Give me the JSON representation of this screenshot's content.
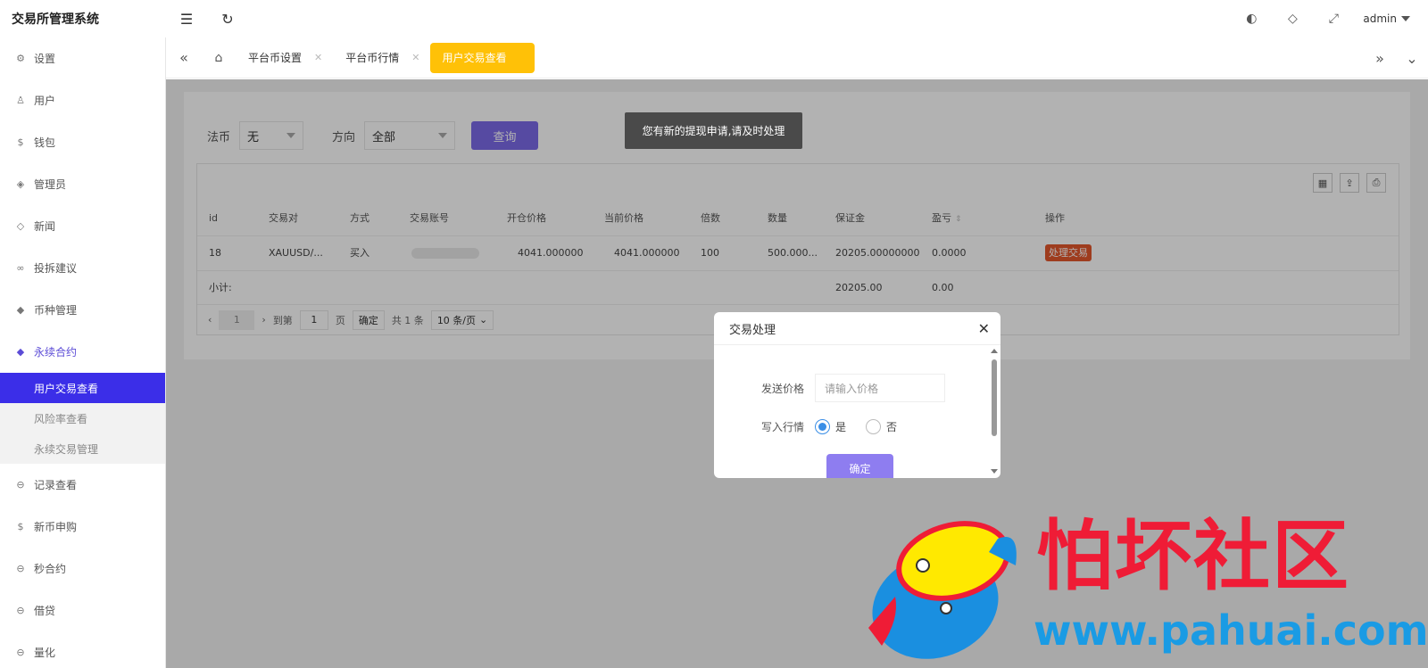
{
  "app": {
    "title": "交易所管理系统"
  },
  "header": {
    "user": "admin"
  },
  "sidebar": {
    "items": [
      {
        "label": "设置",
        "icon": "gear-icon"
      },
      {
        "label": "用户",
        "icon": "user-icon"
      },
      {
        "label": "钱包",
        "icon": "coin-icon"
      },
      {
        "label": "管理员",
        "icon": "shield-icon"
      },
      {
        "label": "新闻",
        "icon": "tag-icon"
      },
      {
        "label": "投拆建议",
        "icon": "link-icon"
      },
      {
        "label": "币种管理",
        "icon": "diamond-icon"
      },
      {
        "label": "永续合约",
        "icon": "diamond-icon"
      },
      {
        "label": "记录查看",
        "icon": "clock-icon"
      },
      {
        "label": "新币申购",
        "icon": "coin-icon"
      },
      {
        "label": "秒合约",
        "icon": "clock-icon"
      },
      {
        "label": "借贷",
        "icon": "clock-icon"
      },
      {
        "label": "量化",
        "icon": "clock-icon"
      }
    ],
    "submenu": [
      "用户交易查看",
      "风险率查看",
      "永续交易管理"
    ]
  },
  "tabs": [
    "平台币设置",
    "平台币行情",
    "用户交易查看"
  ],
  "filter": {
    "fiat_label": "法币",
    "fiat_value": "无",
    "direction_label": "方向",
    "direction_value": "全部",
    "query_button": "查询"
  },
  "table": {
    "columns": [
      "id",
      "交易对",
      "方式",
      "交易账号",
      "开仓价格",
      "当前价格",
      "倍数",
      "数量",
      "保证金",
      "盈亏",
      "操作"
    ],
    "rows": [
      {
        "id": "18",
        "pair": "XAUUSD/...",
        "method": "买入",
        "open_price": "4041.000000",
        "current_price": "4041.000000",
        "multiple": "100",
        "quantity": "500.000...",
        "margin": "20205.00000000",
        "pnl": "0.0000",
        "action": "处理交易"
      }
    ],
    "subtotal": {
      "label": "小计:",
      "margin": "20205.00",
      "pnl": "0.00"
    }
  },
  "pager": {
    "current_page": "1",
    "goto_label": "到第",
    "goto_value": "1",
    "page_unit": "页",
    "confirm": "确定",
    "total": "共 1 条",
    "page_size": "10 条/页"
  },
  "toast": "您有新的提现申请,请及时处理",
  "dialog": {
    "title": "交易处理",
    "price_label": "发送价格",
    "price_placeholder": "请输入价格",
    "market_label": "写入行情",
    "option_yes": "是",
    "option_no": "否",
    "ok": "确定"
  },
  "watermark": {
    "text": "怕坏社区",
    "url": "www.pahuai.com"
  },
  "colors": {
    "accent": "#3b2ee8",
    "tab_active": "#ffc107",
    "handle": "#e2562c",
    "query": "#7b6ae8"
  }
}
